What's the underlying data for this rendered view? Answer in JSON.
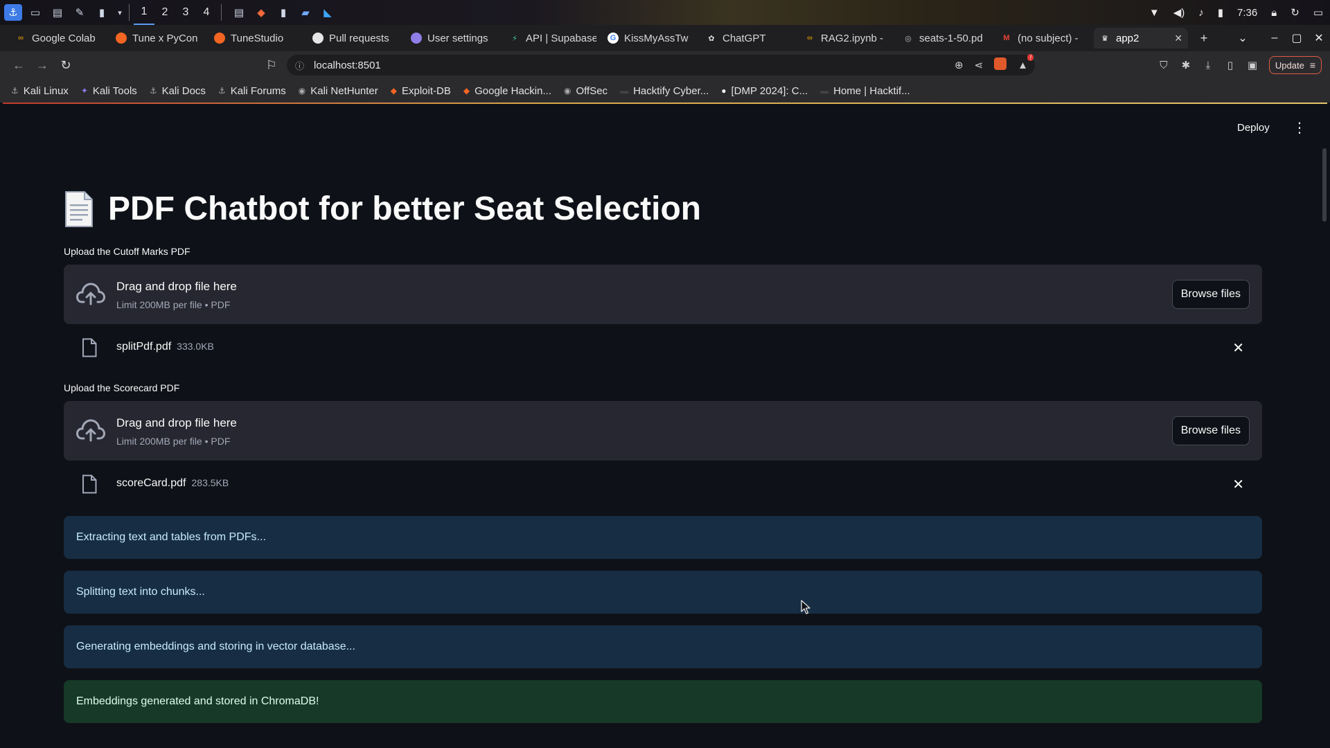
{
  "os": {
    "workspaces": [
      "1",
      "2",
      "3",
      "4"
    ],
    "clock": "7:36"
  },
  "browser": {
    "tabs": [
      {
        "label": "Google Colab",
        "icon": "colab-icon"
      },
      {
        "label": "Tune x PyCon",
        "icon": "tune-icon"
      },
      {
        "label": "TuneStudio",
        "icon": "tune-icon"
      },
      {
        "label": "Pull requests",
        "icon": "github-icon"
      },
      {
        "label": "User settings",
        "icon": "gitlab-icon"
      },
      {
        "label": "API | Supabase",
        "icon": "supabase-icon"
      },
      {
        "label": "KissMyAssTw",
        "icon": "google-icon"
      },
      {
        "label": "ChatGPT",
        "icon": "openai-icon"
      },
      {
        "label": "RAG2.ipynb -",
        "icon": "colab-icon"
      },
      {
        "label": "seats-1-50.pd",
        "icon": "globe-icon"
      },
      {
        "label": "(no subject) -",
        "icon": "gmail-icon"
      },
      {
        "label": "app2",
        "icon": "streamlit-icon"
      }
    ],
    "url": "localhost:8501",
    "update_label": "Update",
    "bookmarks": [
      "Kali Linux",
      "Kali Tools",
      "Kali Docs",
      "Kali Forums",
      "Kali NetHunter",
      "Exploit-DB",
      "Google Hackin...",
      "OffSec",
      "Hacktify Cyber...",
      "[DMP 2024]: C...",
      "Home | Hacktif..."
    ]
  },
  "app": {
    "deploy_label": "Deploy",
    "title": "PDF Chatbot for better Seat Selection",
    "uploads": [
      {
        "label": "Upload the Cutoff Marks PDF",
        "dropzone_text": "Drag and drop file here",
        "dropzone_hint": "Limit 200MB per file • PDF",
        "browse_label": "Browse files",
        "file": {
          "name": "splitPdf.pdf",
          "size": "333.0KB"
        }
      },
      {
        "label": "Upload the Scorecard PDF",
        "dropzone_text": "Drag and drop file here",
        "dropzone_hint": "Limit 200MB per file • PDF",
        "browse_label": "Browse files",
        "file": {
          "name": "scoreCard.pdf",
          "size": "283.5KB"
        }
      }
    ],
    "status_messages": [
      {
        "text": "Extracting text and tables from PDFs...",
        "kind": "info"
      },
      {
        "text": "Splitting text into chunks...",
        "kind": "info"
      },
      {
        "text": "Generating embeddings and storing in vector database...",
        "kind": "info"
      },
      {
        "text": "Embeddings generated and stored in ChromaDB!",
        "kind": "success"
      }
    ]
  },
  "colors": {
    "app_background": "#0e1117",
    "dropzone_background": "#262730",
    "info_background": "#172d43",
    "info_text": "#c7ebff",
    "success_background": "#173928",
    "success_text": "#dffde9"
  }
}
